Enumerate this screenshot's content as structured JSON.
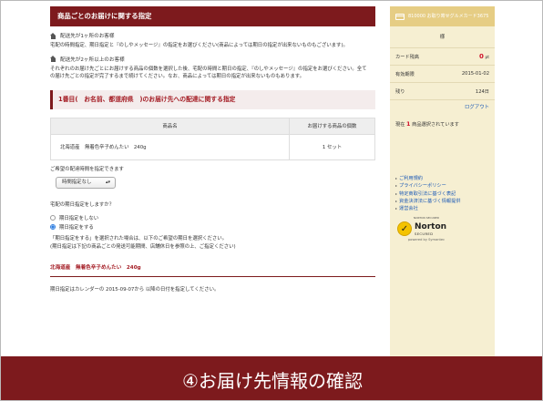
{
  "main": {
    "title": "商品ごとのお届けに関する指定",
    "dest_single": {
      "heading": "配送先が1ヶ所のお客様",
      "text": "宅配の時間指定、期日指定と『のしやメッセージ』の指定をお選びください(商品によっては期日の指定が出来ないものもございます)。"
    },
    "dest_multi": {
      "heading": "配送先が2ヶ所以上のお客様",
      "text1": "それぞれのお届け先ごとにお届けする商品の個数を選択した後、宅配の時間と期日の指定、『のしやメッセージ』の指定をお選びください。全て",
      "text2": "の届け先ごとの指定が完了するまで続けてください。なお、商品によっては期日の指定が出来ないものもあります。"
    },
    "section_heading": "1番目(　お名前、都道府県　)のお届け先への配達に関する指定",
    "table": {
      "headers": [
        "商品名",
        "お届けする商品の個数"
      ],
      "rows": [
        [
          "北海道産　無着色辛子めんたい　240g",
          "1 セット"
        ]
      ]
    },
    "time_label": "ご希望の配達時間を指定できます",
    "time_select": "時間指定なし",
    "date_question": "宅配の期日指定をしますか？",
    "radio_options": [
      "期日指定をしない",
      "期日指定をする"
    ],
    "note1": "「期日指定をする」を選択された場合は、以下のご希望の期日を選択ください。",
    "note2": "(期日指定は下記の商品ごとの発送可能期間、店舗休日を参照の上、ご指定ください)",
    "product_heading": "北海道産　無着色辛子めんたい　240g",
    "availability": "期日指定はカレンダーの 2015-09-07から 以降の日付を指定してください。"
  },
  "sidebar": {
    "card_title": "810000 お取り寄せグルメカード3675",
    "name_suffix": "様",
    "points_label": "カード残高",
    "points_value": "0",
    "points_unit": "pt",
    "expiry_label": "有効期限",
    "expiry_value": "2015-01-02",
    "days_label": "残り",
    "days_value": "124日",
    "logout": "ログアウト",
    "cart_prefix": "現在",
    "cart_count": "1",
    "cart_suffix": "商品選択されています",
    "links": [
      "ご利用規約",
      "プライバシーポリシー",
      "特定商取引法に基づく表記",
      "資金決済法に基づく情報提供",
      "運営会社"
    ],
    "norton": {
      "top_text": "NORTON SECURED",
      "brand": "Norton",
      "secured": "SECURED",
      "powered": "powered by Symantec"
    }
  },
  "banner": {
    "text": "④お届け先情報の確認"
  },
  "colors": {
    "brand_maroon": "#7d1a1d",
    "accent_red": "#d0112b",
    "sidebar_bg": "#f6efd2",
    "sidebar_head": "#e6cd84",
    "link_blue": "#1b59b6"
  }
}
